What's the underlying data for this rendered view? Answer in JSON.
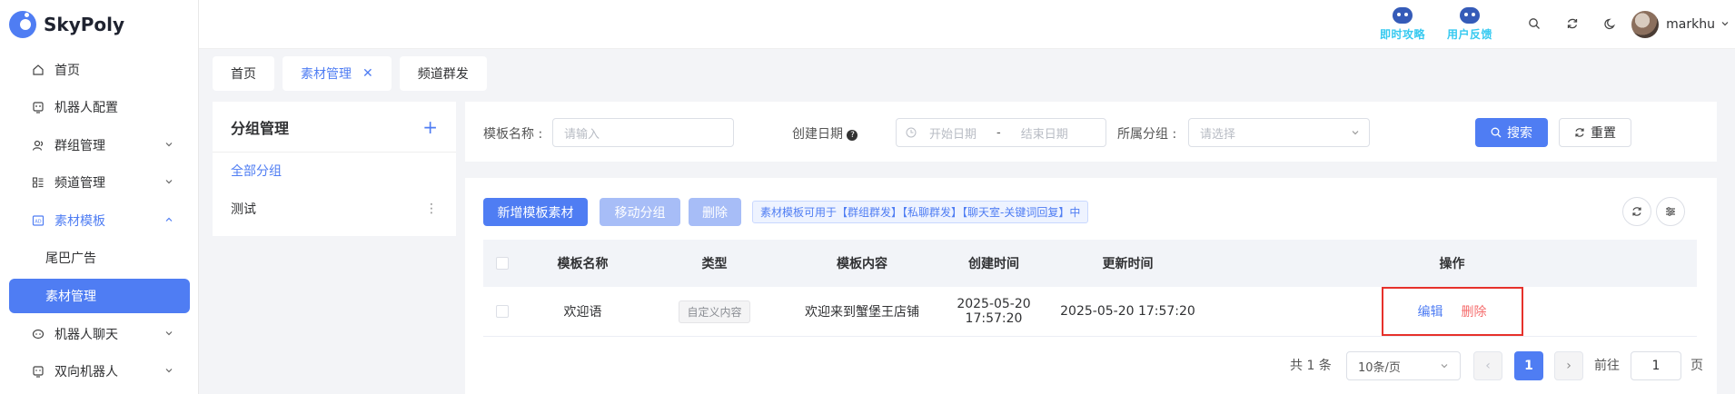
{
  "app": {
    "name": "SkyPoly"
  },
  "sidebar": {
    "items": [
      {
        "label": "首页",
        "icon": "home-icon"
      },
      {
        "label": "机器人配置",
        "icon": "robot-config-icon"
      },
      {
        "label": "群组管理",
        "icon": "group-icon"
      },
      {
        "label": "频道管理",
        "icon": "channel-icon"
      },
      {
        "label": "素材模板",
        "icon": "template-icon"
      },
      {
        "label": "机器人聊天",
        "icon": "chat-icon"
      },
      {
        "label": "双向机器人",
        "icon": "two-way-robot-icon"
      }
    ],
    "subitems": [
      {
        "label": "尾巴广告"
      },
      {
        "label": "素材管理"
      }
    ]
  },
  "header": {
    "btn_guide": "即时攻略",
    "btn_feedback": "用户反馈",
    "username": "markhu"
  },
  "tabs": [
    {
      "label": "首页"
    },
    {
      "label": "素材管理"
    },
    {
      "label": "频道群发"
    }
  ],
  "groups": {
    "title": "分组管理",
    "add": "+",
    "all": "全部分组",
    "items": [
      {
        "label": "测试"
      }
    ]
  },
  "filter": {
    "name_label": "模板名称 :",
    "name_placeholder": "请输入",
    "date_label": "创建日期",
    "date_start": "开始日期",
    "date_sep": "-",
    "date_end": "结束日期",
    "group_label": "所属分组 :",
    "group_placeholder": "请选择",
    "search": "搜索",
    "reset": "重置"
  },
  "toolbar": {
    "add": "新增模板素材",
    "move": "移动分组",
    "delete": "删除",
    "tip": "素材模板可用于【群组群发】【私聊群发】【聊天室-关键词回复】中"
  },
  "table": {
    "headers": [
      "模板名称",
      "类型",
      "模板内容",
      "创建时间",
      "更新时间",
      "操作"
    ],
    "rows": [
      {
        "name": "欢迎语",
        "type": "自定义内容",
        "content": "欢迎来到蟹堡王店铺",
        "created": "2025-05-20 17:57:20",
        "updated": "2025-05-20 17:57:20",
        "edit": "编辑",
        "delete": "删除"
      }
    ]
  },
  "pagination": {
    "total": "共 1 条",
    "page_size": "10条/页",
    "current": "1",
    "goto": "前往",
    "goto_value": "1",
    "unit": "页"
  },
  "colors": {
    "primary": "#4f7df3",
    "danger": "#f56c6c",
    "highlight_box": "#e6312b"
  }
}
